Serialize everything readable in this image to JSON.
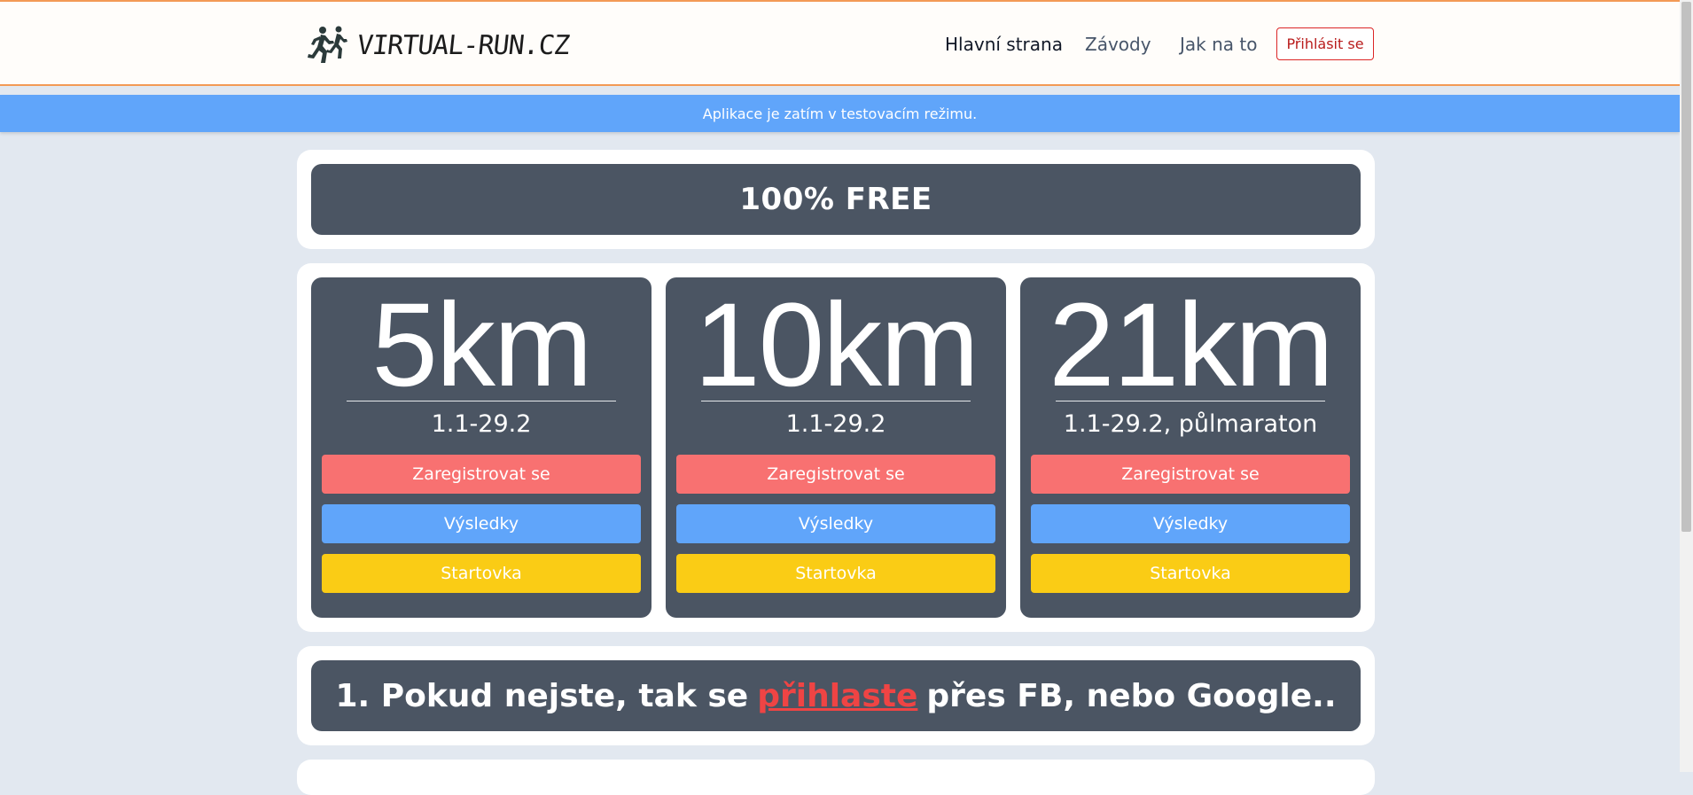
{
  "header": {
    "logo_text": "VIRTUAL-RUN.CZ",
    "nav": [
      {
        "label": "Hlavní strana"
      },
      {
        "label": "Závody"
      },
      {
        "label": "Jak na to"
      }
    ],
    "login_label": "Přihlásit se"
  },
  "notice": "Aplikace je zatím v testovacím režimu.",
  "promo": "100% FREE",
  "races": [
    {
      "distance": "5km",
      "dates": "1.1-29.2",
      "register": "Zaregistrovat se",
      "results": "Výsledky",
      "start_list": "Startovka"
    },
    {
      "distance": "10km",
      "dates": "1.1-29.2",
      "register": "Zaregistrovat se",
      "results": "Výsledky",
      "start_list": "Startovka"
    },
    {
      "distance": "21km",
      "dates": "1.1-29.2, půlmaraton",
      "register": "Zaregistrovat se",
      "results": "Výsledky",
      "start_list": "Startovka"
    }
  ],
  "step1": {
    "before": "1. Pokud nejste, tak se",
    "link": "přihlaste",
    "after": "přes FB, nebo Google.."
  },
  "colors": {
    "accent_orange": "#f39a55",
    "notice_blue": "#60a5fa",
    "card_dark": "#4b5563",
    "register_red": "#f87171",
    "results_blue": "#60a5fa",
    "startlist_yellow": "#facc15",
    "link_red": "#ef4444"
  },
  "icons": {
    "logo": "runners-icon"
  }
}
